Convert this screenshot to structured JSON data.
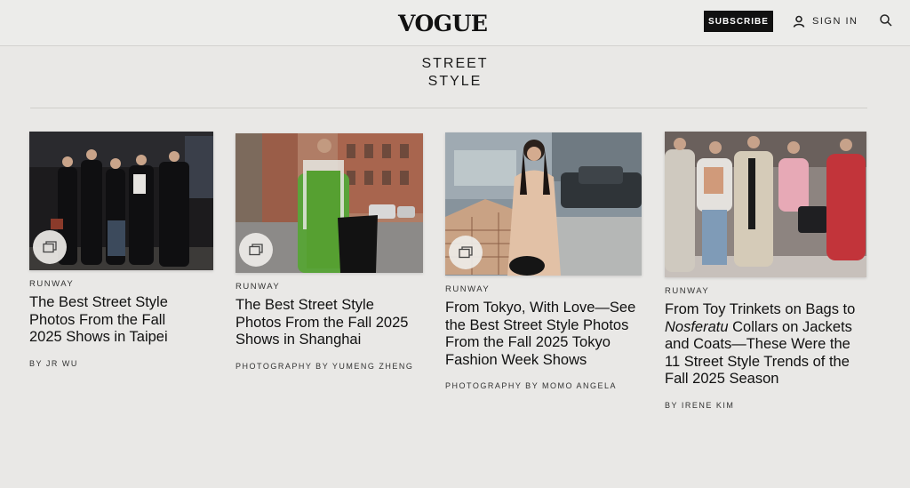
{
  "header": {
    "logo": "VOGUE",
    "subscribe_label": "SUBSCRIBE",
    "signin_label": "SIGN IN"
  },
  "section": {
    "title_line1": "STREET",
    "title_line2": "STYLE"
  },
  "articles": [
    {
      "kicker": "RUNWAY",
      "headline": "The Best Street Style Photos From the Fall 2025 Shows in Taipei",
      "byline": "BY JR WU"
    },
    {
      "kicker": "RUNWAY",
      "headline": "The Best Street Style Photos From the Fall 2025 Shows in Shanghai",
      "byline": "PHOTOGRAPHY BY YUMENG ZHENG"
    },
    {
      "kicker": "RUNWAY",
      "headline": "From Tokyo, With Love—See the Best Street Style Photos From the Fall 2025 Tokyo Fashion Week Shows",
      "byline": "PHOTOGRAPHY BY MOMO ANGELA"
    },
    {
      "kicker": "RUNWAY",
      "headline_pre": "From Toy Trinkets on Bags to ",
      "headline_em": "Nosferatu",
      "headline_post": " Collars on Jackets and Coats—These Were the 11 Street Style Trends of the Fall 2025 Season",
      "byline": "BY IRENE KIM"
    }
  ],
  "icons": {
    "user": "user-icon",
    "search": "search-icon",
    "gallery": "gallery-icon"
  }
}
